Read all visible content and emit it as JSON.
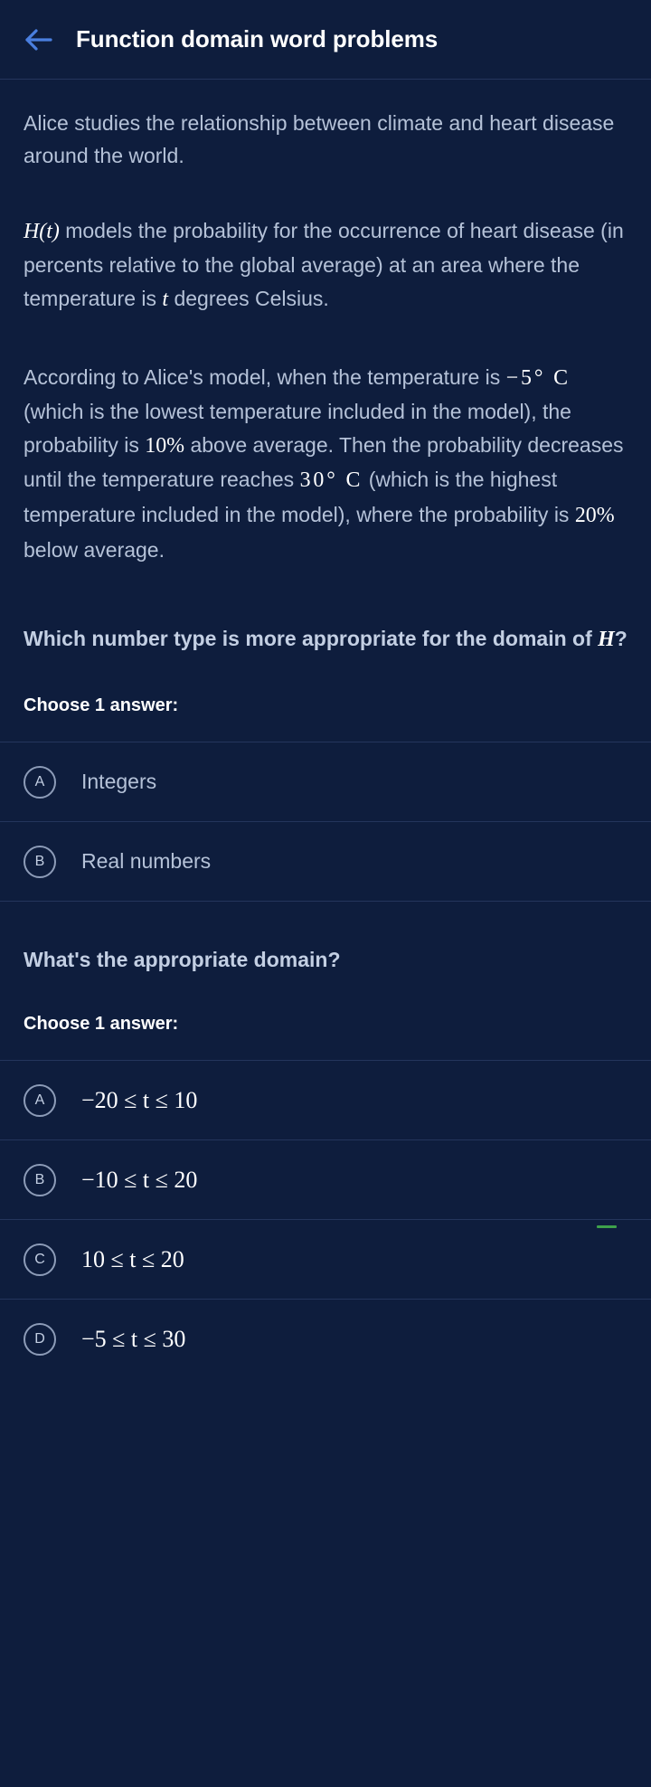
{
  "header": {
    "back_icon": "arrow-left-icon",
    "title": "Function domain word problems",
    "accent_color": "#4a7fe0"
  },
  "passage": {
    "paragraph_1": "Alice studies the relationship between climate and heart disease around the world.",
    "paragraph_2": {
      "math_1": "H(t)",
      "text_1": " models the probability for the occurrence of heart disease (in percents relative to the global average) at an area where the temperature is ",
      "math_2": "t",
      "text_2": " degrees Celsius."
    },
    "paragraph_3": {
      "text_1": "According to Alice's model, when the temperature is ",
      "math_1": "−5° C",
      "text_2": " (which is the lowest temperature included in the model), the probability is ",
      "math_2": "10%",
      "text_3": " above average. Then the probability decreases until the temperature reaches ",
      "math_3": "30° C",
      "text_4": " (which is the highest temperature included in the model), where the probability is ",
      "math_4": "20%",
      "text_5": " below average."
    }
  },
  "question_1": {
    "prompt_text_1": "Which number type is more appropriate for the domain of ",
    "prompt_math": "H",
    "prompt_text_2": "?",
    "choose_label": "Choose 1 answer:",
    "choices": [
      {
        "letter": "A",
        "label": "Integers"
      },
      {
        "letter": "B",
        "label": "Real numbers"
      }
    ]
  },
  "question_2": {
    "prompt": "What's the appropriate domain?",
    "choose_label": "Choose 1 answer:",
    "choices": [
      {
        "letter": "A",
        "label": "−20 ≤ t ≤ 10"
      },
      {
        "letter": "B",
        "label": "−10 ≤ t ≤ 20"
      },
      {
        "letter": "C",
        "label": "10 ≤ t ≤ 20"
      },
      {
        "letter": "D",
        "label": "−5 ≤ t ≤ 30"
      }
    ]
  },
  "colors": {
    "background": "#0e1d3d",
    "divider": "#24355c",
    "body_text": "#b5c2d8",
    "strong_text": "#ffffff",
    "marker_green": "#3ea14b"
  }
}
